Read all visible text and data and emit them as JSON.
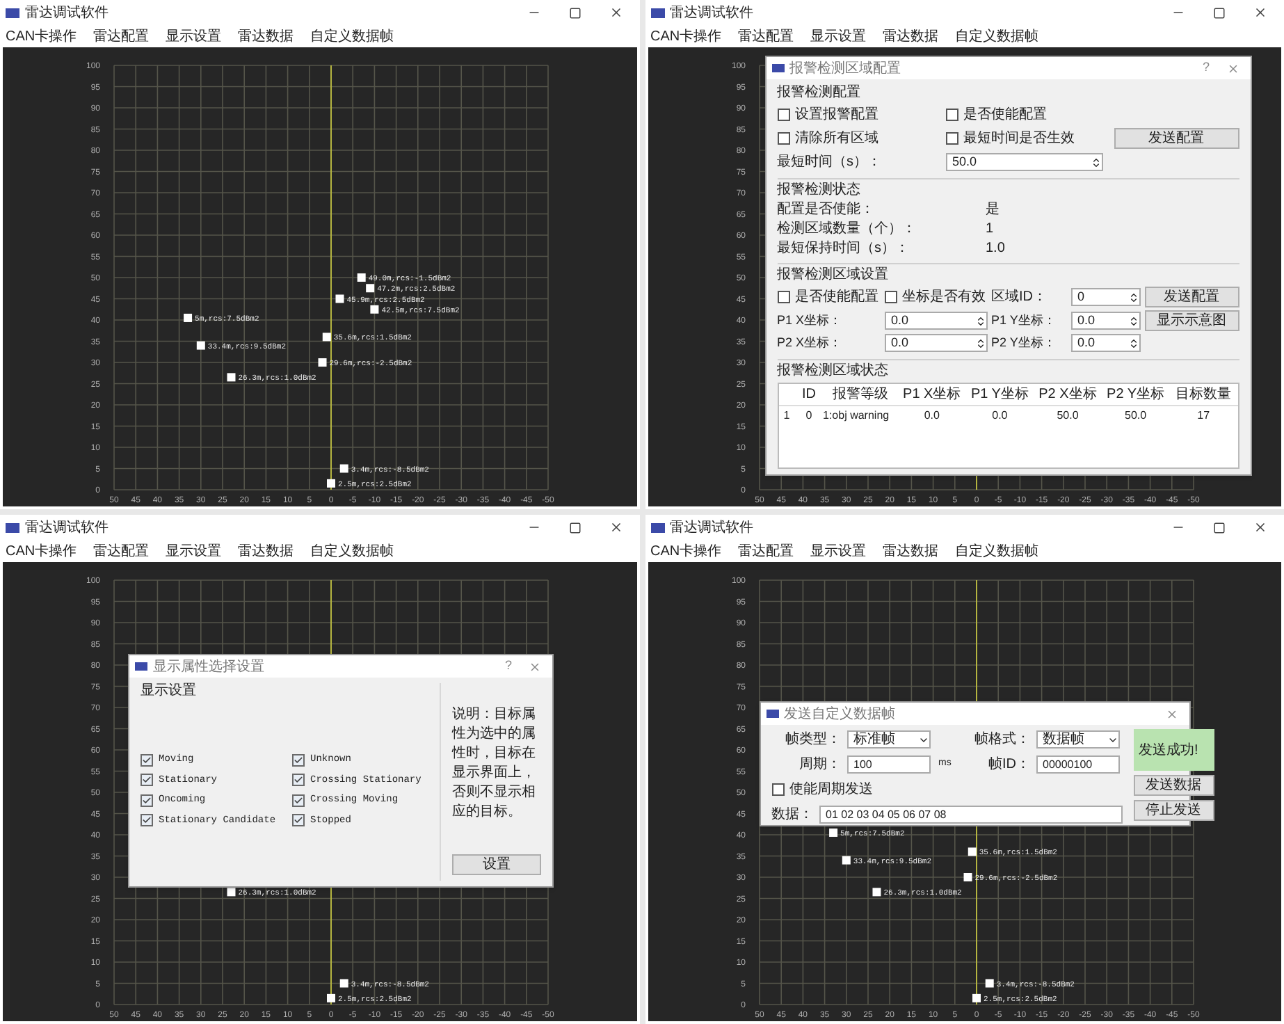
{
  "windows": [
    {
      "title": "雷达调试软件",
      "menu": [
        "CAN卡操作",
        "雷达配置",
        "显示设置",
        "雷达数据",
        "自定义数据帧"
      ],
      "chart_data": {
        "type": "scatter",
        "grid": true,
        "ref_lines": [
          {
            "axis": "x",
            "value": 0,
            "color": "#b5b540"
          }
        ],
        "xlim": [
          50,
          -50
        ],
        "ylim": [
          0,
          100
        ],
        "xticks": [
          50,
          45,
          40,
          35,
          30,
          25,
          20,
          15,
          10,
          5,
          0,
          -5,
          -10,
          -15,
          -20,
          -25,
          -30,
          -35,
          -40,
          -45,
          -50
        ],
        "yticks": [
          0,
          5,
          10,
          15,
          20,
          25,
          30,
          35,
          40,
          45,
          50,
          55,
          60,
          65,
          70,
          75,
          80,
          85,
          90,
          95,
          100
        ],
        "x": [
          -7,
          -9,
          -2,
          -10,
          33,
          1,
          30,
          2,
          23,
          -3,
          0
        ],
        "series": [
          {
            "color": "#ffffff",
            "values": [
              50,
              47.5,
              45,
              42.5,
              40.5,
              36,
              34,
              30,
              26.5,
              5,
              1.5
            ]
          }
        ],
        "annotations": [
          {
            "x": -7,
            "y": 50,
            "text": "49.0m,rcs:-1.5dBm2"
          },
          {
            "x": -9,
            "y": 47.5,
            "text": "47.2m,rcs:2.5dBm2"
          },
          {
            "x": -2,
            "y": 45,
            "text": "45.9m,rcs:2.5dBm2"
          },
          {
            "x": -10,
            "y": 42.5,
            "text": "42.5m,rcs:7.5dBm2"
          },
          {
            "x": 33,
            "y": 40.5,
            "text": "5m,rcs:7.5dBm2"
          },
          {
            "x": 1,
            "y": 36,
            "text": "35.6m,rcs:1.5dBm2"
          },
          {
            "x": 30,
            "y": 34,
            "text": "33.4m,rcs:9.5dBm2"
          },
          {
            "x": 2,
            "y": 30,
            "text": "29.6m,rcs:-2.5dBm2"
          },
          {
            "x": 23,
            "y": 26.5,
            "text": "26.3m,rcs:1.0dBm2"
          },
          {
            "x": -3,
            "y": 5,
            "text": "3.4m,rcs:-8.5dBm2"
          },
          {
            "x": 0,
            "y": 1.5,
            "text": "2.5m,rcs:2.5dBm2"
          }
        ]
      }
    },
    {
      "title": "雷达调试软件",
      "menu": [
        "CAN卡操作",
        "雷达配置",
        "显示设置",
        "雷达数据",
        "自定义数据帧"
      ],
      "chart_data": {
        "type": "scatter",
        "grid": true,
        "ref_lines": [
          {
            "axis": "x",
            "value": 0,
            "color": "#b5b540"
          }
        ],
        "xlim": [
          50,
          -50
        ],
        "ylim": [
          0,
          100
        ],
        "xticks": [
          50,
          45,
          40,
          35,
          30,
          25,
          20,
          15,
          10,
          5,
          0,
          -5,
          -10,
          -15,
          -20,
          -25,
          -30,
          -35,
          -40,
          -45,
          -50
        ],
        "yticks": [
          0,
          5,
          10,
          15,
          20,
          25,
          30,
          35,
          40,
          45,
          50,
          55,
          60,
          65,
          70,
          75,
          80,
          85,
          90,
          95,
          100
        ]
      },
      "dialog": {
        "kind": "alarm_zone",
        "title": "报警检测区域配置",
        "help": "?",
        "config": {
          "heading": "报警检测配置",
          "checks": [
            {
              "label": "设置报警配置",
              "checked": false
            },
            {
              "label": "是否使能配置",
              "checked": false
            },
            {
              "label": "清除所有区域",
              "checked": false
            },
            {
              "label": "最短时间是否生效",
              "checked": false
            }
          ],
          "time_label": "最短时间（s）：",
          "time_value": "50.0",
          "send": "发送配置"
        },
        "status": {
          "heading": "报警检测状态",
          "rows": [
            {
              "label": "配置是否使能：",
              "value": "是"
            },
            {
              "label": "检测区域数量（个）：",
              "value": "1"
            },
            {
              "label": "最短保持时间（s）：",
              "value": "1.0"
            }
          ]
        },
        "zone": {
          "heading": "报警检测区域设置",
          "checks": [
            {
              "label": "是否使能配置",
              "checked": false
            },
            {
              "label": "坐标是否有效",
              "checked": false
            }
          ],
          "id_label": "区域ID：",
          "id_value": "0",
          "fields": [
            {
              "label": "P1 X坐标：",
              "value": "0.0"
            },
            {
              "label": "P1 Y坐标：",
              "value": "0.0"
            },
            {
              "label": "P2 X坐标：",
              "value": "0.0"
            },
            {
              "label": "P2 Y坐标：",
              "value": "0.0"
            }
          ],
          "buttons": [
            "发送配置",
            "显示示意图"
          ]
        },
        "table": {
          "heading": "报警检测区域状态",
          "columns": [
            "ID",
            "报警等级",
            "P1 X坐标",
            "P1 Y坐标",
            "P2 X坐标",
            "P2 Y坐标",
            "目标数量"
          ],
          "rows": [
            {
              "header": "1",
              "cells": [
                "0",
                "1:obj warning",
                "0.0",
                "0.0",
                "50.0",
                "50.0",
                "17"
              ]
            }
          ]
        }
      }
    },
    {
      "title": "雷达调试软件",
      "menu": [
        "CAN卡操作",
        "雷达配置",
        "显示设置",
        "雷达数据",
        "自定义数据帧"
      ],
      "chart_data": {
        "type": "scatter",
        "grid": true,
        "ref_lines": [
          {
            "axis": "x",
            "value": 0,
            "color": "#b5b540"
          }
        ],
        "xlim": [
          50,
          -50
        ],
        "ylim": [
          0,
          100
        ],
        "xticks": [
          50,
          45,
          40,
          35,
          30,
          25,
          20,
          15,
          10,
          5,
          0,
          -5,
          -10,
          -15,
          -20,
          -25,
          -30,
          -35,
          -40,
          -45,
          -50
        ],
        "yticks": [
          0,
          5,
          10,
          15,
          20,
          25,
          30,
          35,
          40,
          45,
          50,
          55,
          60,
          65,
          70,
          75,
          80,
          85,
          90,
          95,
          100
        ],
        "x": [
          23,
          -3,
          0
        ],
        "series": [
          {
            "color": "#ffffff",
            "values": [
              26.5,
              5,
              1.5
            ]
          }
        ],
        "annotations": [
          {
            "x": 23,
            "y": 26.5,
            "text": "26.3m,rcs:1.0dBm2"
          },
          {
            "x": -3,
            "y": 5,
            "text": "3.4m,rcs:-8.5dBm2"
          },
          {
            "x": 0,
            "y": 1.5,
            "text": "2.5m,rcs:2.5dBm2"
          }
        ]
      },
      "dialog": {
        "kind": "display_filter",
        "title": "显示属性选择设置",
        "help": "?",
        "group": "显示设置",
        "options": [
          {
            "label": "Moving",
            "checked": true
          },
          {
            "label": "Stationary",
            "checked": true
          },
          {
            "label": "Oncoming",
            "checked": true
          },
          {
            "label": "Stationary Candidate",
            "checked": true
          },
          {
            "label": "Unknown",
            "checked": true
          },
          {
            "label": "Crossing Stationary",
            "checked": true
          },
          {
            "label": "Crossing Moving",
            "checked": true
          },
          {
            "label": "Stopped",
            "checked": true
          }
        ],
        "note": "说明：目标属性为选中的属性时，目标在显示界面上，否则不显示相应的目标。",
        "button": "设置"
      }
    },
    {
      "title": "雷达调试软件",
      "menu": [
        "CAN卡操作",
        "雷达配置",
        "显示设置",
        "雷达数据",
        "自定义数据帧"
      ],
      "chart_data": {
        "type": "scatter",
        "grid": true,
        "ref_lines": [
          {
            "axis": "x",
            "value": 0,
            "color": "#b5b540"
          }
        ],
        "xlim": [
          50,
          -50
        ],
        "ylim": [
          0,
          100
        ],
        "xticks": [
          50,
          45,
          40,
          35,
          30,
          25,
          20,
          15,
          10,
          5,
          0,
          -5,
          -10,
          -15,
          -20,
          -25,
          -30,
          -35,
          -40,
          -45,
          -50
        ],
        "yticks": [
          0,
          5,
          10,
          15,
          20,
          25,
          30,
          35,
          40,
          45,
          50,
          55,
          60,
          65,
          70,
          75,
          80,
          85,
          90,
          95,
          100
        ],
        "x": [
          33,
          1,
          30,
          2,
          23,
          -3,
          0
        ],
        "series": [
          {
            "color": "#ffffff",
            "values": [
              40.5,
              36,
              34,
              30,
              26.5,
              5,
              1.5
            ]
          }
        ],
        "annotations": [
          {
            "x": 33,
            "y": 40.5,
            "text": "5m,rcs:7.5dBm2"
          },
          {
            "x": 1,
            "y": 36,
            "text": "35.6m,rcs:1.5dBm2"
          },
          {
            "x": 30,
            "y": 34,
            "text": "33.4m,rcs:9.5dBm2"
          },
          {
            "x": 2,
            "y": 30,
            "text": "29.6m,rcs:-2.5dBm2"
          },
          {
            "x": 23,
            "y": 26.5,
            "text": "26.3m,rcs:1.0dBm2"
          },
          {
            "x": -3,
            "y": 5,
            "text": "3.4m,rcs:-8.5dBm2"
          },
          {
            "x": 0,
            "y": 1.5,
            "text": "2.5m,rcs:2.5dBm2"
          }
        ]
      },
      "dialog": {
        "kind": "custom_frame",
        "title": "发送自定义数据帧",
        "type_label": "帧类型：",
        "type_value": "标准帧",
        "format_label": "帧格式：",
        "format_value": "数据帧",
        "period_label": "周期：",
        "period_value": "100",
        "period_unit": "ms",
        "id_label": "帧ID：",
        "id_value": "00000100",
        "periodic": {
          "label": "使能周期发送",
          "checked": false
        },
        "data_label": "数据：",
        "data_value": "01 02 03 04 05 06 07 08",
        "status": "发送成功!",
        "buttons": [
          "发送数据",
          "停止发送"
        ]
      }
    }
  ]
}
